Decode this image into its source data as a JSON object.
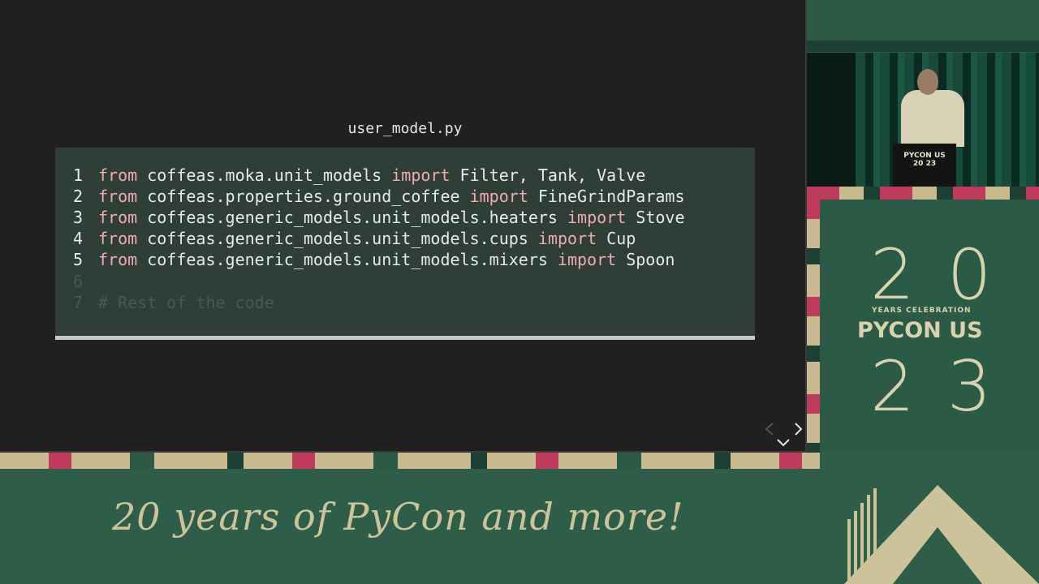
{
  "slide": {
    "filename": "user_model.py",
    "code_lines": [
      {
        "num": "1",
        "from": "from",
        "module": " coffeas.moka.unit_models ",
        "import": "import",
        "names": " Filter, Tank, Valve"
      },
      {
        "num": "2",
        "from": "from",
        "module": " coffeas.properties.ground_coffee ",
        "import": "import",
        "names": " FineGrindParams"
      },
      {
        "num": "3",
        "from": "from",
        "module": " coffeas.generic_models.unit_models.heaters ",
        "import": "import",
        "names": " Stove"
      },
      {
        "num": "4",
        "from": "from",
        "module": " coffeas.generic_models.unit_models.cups ",
        "import": "import",
        "names": " Cup"
      },
      {
        "num": "5",
        "from": "from",
        "module": " coffeas.generic_models.unit_models.mixers ",
        "import": "import",
        "names": " Spoon"
      }
    ],
    "faded_lines": [
      {
        "num": "6",
        "text": ""
      },
      {
        "num": "7",
        "text": "# Rest of the code"
      }
    ]
  },
  "branding": {
    "year_top": "20",
    "years_celebration": "YEARS CELEBRATION",
    "conference": "PYCON US",
    "year_bottom": "23",
    "podium_label": "PYCON US",
    "podium_year": "20 23",
    "tagline": "20 years of PyCon and more!"
  },
  "colors": {
    "slide_bg": "#202020",
    "code_bg": "#2f3f38",
    "keyword": "#f0a9b8",
    "brand_green": "#2b5a47",
    "brand_cream": "#d9d1b0",
    "brand_pink": "#c03a5c"
  },
  "icons": {
    "prev": "chevron-left-icon",
    "next": "chevron-right-icon",
    "down": "chevron-down-icon"
  }
}
